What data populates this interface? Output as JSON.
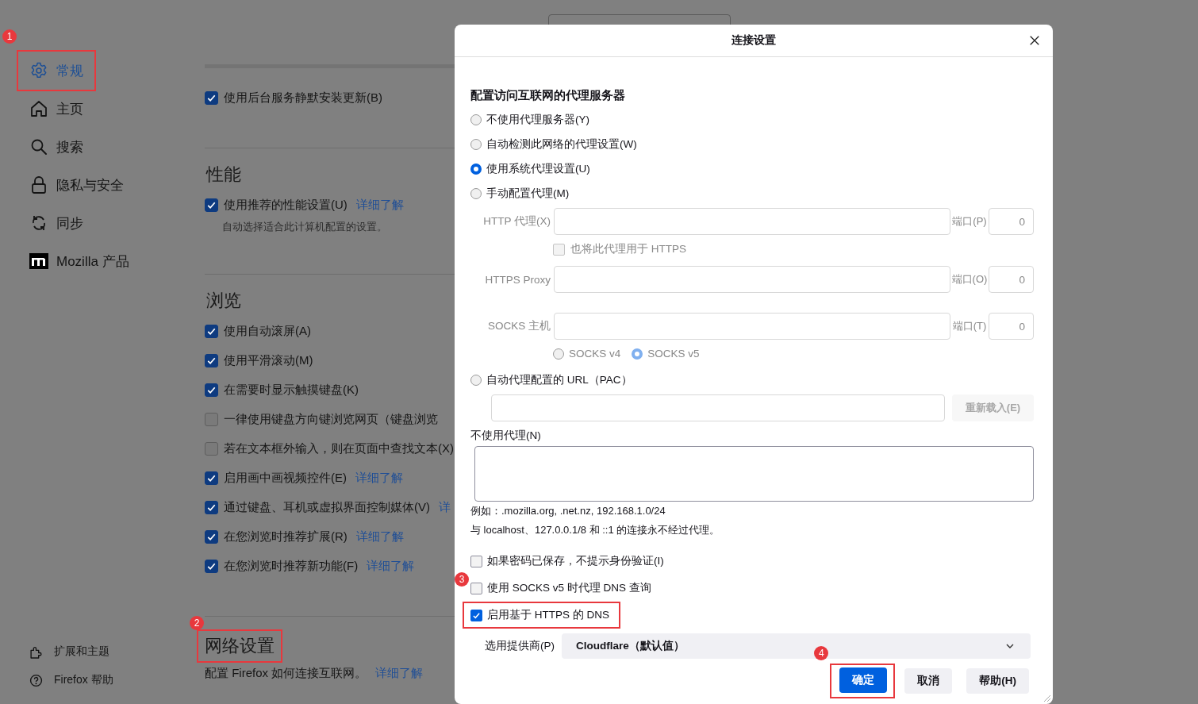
{
  "sidebar": {
    "items": [
      {
        "label": "常规",
        "selected": true,
        "highlighted": true,
        "marker": "1"
      },
      {
        "label": "主页",
        "selected": false,
        "highlighted": false
      },
      {
        "label": "搜索",
        "selected": false,
        "highlighted": false
      },
      {
        "label": "隐私与安全",
        "selected": false,
        "highlighted": false
      },
      {
        "label": "同步",
        "selected": false,
        "highlighted": false
      },
      {
        "label": "Mozilla 产品",
        "selected": false,
        "highlighted": false
      }
    ],
    "footer_items": [
      {
        "label": "扩展和主题"
      },
      {
        "label": "Firefox 帮助"
      }
    ]
  },
  "content": {
    "sections": [
      {
        "rows": [
          {
            "kind": "checkbox",
            "label": "使用后台服务静默安装更新(B)",
            "checked": true
          }
        ]
      },
      {
        "heading": "性能",
        "highlighted": false,
        "rows": [
          {
            "kind": "checkbox",
            "label": "使用推荐的性能设置(U)",
            "checked": true,
            "link": "详细了解"
          },
          {
            "kind": "note",
            "text": "自动选择适合此计算机配置的设置。"
          }
        ]
      },
      {
        "heading": "浏览",
        "highlighted": false,
        "rows": [
          {
            "kind": "checkbox",
            "label": "使用自动滚屏(A)",
            "checked": true
          },
          {
            "kind": "checkbox",
            "label": "使用平滑滚动(M)",
            "checked": true
          },
          {
            "kind": "checkbox",
            "label": "在需要时显示触摸键盘(K)",
            "checked": true
          },
          {
            "kind": "checkbox",
            "label": "一律使用键盘方向键浏览网页（键盘浏览",
            "checked": false
          },
          {
            "kind": "checkbox",
            "label": "若在文本框外输入，则在页面中查找文本(X)",
            "checked": false
          },
          {
            "kind": "checkbox",
            "label": "启用画中画视频控件(E)",
            "checked": true,
            "link": "详细了解"
          },
          {
            "kind": "checkbox",
            "label": "通过键盘、耳机或虚拟界面控制媒体(V)",
            "checked": true,
            "link": "详"
          },
          {
            "kind": "checkbox",
            "label": "在您浏览时推荐扩展(R)",
            "checked": true,
            "link": "详细了解"
          },
          {
            "kind": "checkbox",
            "label": "在您浏览时推荐新功能(F)",
            "checked": true,
            "link": "详细了解"
          }
        ]
      },
      {
        "heading": "网络设置",
        "highlighted": true,
        "marker": "2",
        "rows": [
          {
            "kind": "text",
            "text": "配置 Firefox 如何连接互联网。",
            "link": "详细了解"
          }
        ]
      }
    ]
  },
  "dialog": {
    "title": "连接设置",
    "proxy_heading": "配置访问互联网的代理服务器",
    "proxy_options": [
      {
        "kind": "plain",
        "label": "不使用代理服务器(Y)",
        "selected": false
      },
      {
        "kind": "plain",
        "label": "自动检测此网络的代理设置(W)",
        "selected": false
      },
      {
        "kind": "plain",
        "label": "使用系统代理设置(U)",
        "selected": true
      },
      {
        "kind": "manual",
        "label": "手动配置代理(M)",
        "selected": false
      },
      {
        "kind": "pac",
        "label": "自动代理配置的 URL（PAC）",
        "selected": false
      }
    ],
    "manual": {
      "disabled": true,
      "rows": [
        {
          "kind": "field",
          "label": "HTTP 代理(X)",
          "port_label": "端口(P)",
          "port_value": "0"
        },
        {
          "kind": "checkbox",
          "label": "也将此代理用于 HTTPS",
          "checked": false
        },
        {
          "kind": "field",
          "label": "HTTPS Proxy",
          "port_label": "端口(O)",
          "port_value": "0"
        },
        {
          "kind": "field",
          "label": "SOCKS 主机",
          "port_label": "端口(T)",
          "port_value": "0"
        },
        {
          "kind": "radios",
          "options": [
            {
              "label": "SOCKS v4",
              "selected": false
            },
            {
              "label": "SOCKS v5",
              "selected": true
            }
          ]
        }
      ]
    },
    "pac": {
      "disabled": true,
      "reload_button": "重新载入(E)"
    },
    "no_proxy": {
      "label": "不使用代理(N)",
      "example": "例如：.mozilla.org, .net.nz, 192.168.1.0/24",
      "note": "与 localhost、127.0.0.1/8 和 ::1 的连接永不经过代理。"
    },
    "options": [
      {
        "label": "如果密码已保存，不提示身份验证(I)",
        "checked": false
      },
      {
        "label": "使用 SOCKS v5 时代理 DNS 查询",
        "checked": false,
        "marker": "3"
      },
      {
        "label": "启用基于 HTTPS 的 DNS",
        "checked": true,
        "highlighted": true
      }
    ],
    "provider": {
      "label": "选用提供商(P)",
      "value": "Cloudflare（默认值）"
    },
    "buttons": [
      {
        "label": "确定",
        "primary": true,
        "highlighted": true,
        "marker": "4"
      },
      {
        "label": "取消",
        "primary": false
      },
      {
        "label": "帮助(H)",
        "primary": false
      }
    ]
  }
}
